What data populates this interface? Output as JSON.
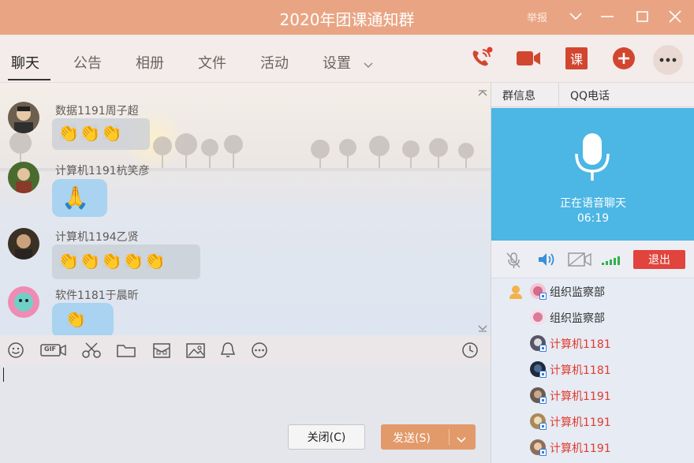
{
  "window": {
    "title": "2020年团课通知群",
    "report_label": "举报",
    "controls": [
      "chevron-down-icon",
      "minimize-icon",
      "maximize-icon",
      "close-icon"
    ]
  },
  "tabs": [
    {
      "label": "聊天",
      "active": true
    },
    {
      "label": "公告",
      "active": false
    },
    {
      "label": "相册",
      "active": false
    },
    {
      "label": "文件",
      "active": false
    },
    {
      "label": "活动",
      "active": false
    },
    {
      "label": "设置",
      "active": false
    }
  ],
  "actions": {
    "call_icon": "phone-call-icon",
    "video_icon": "video-camera-icon",
    "course_label": "课",
    "add_icon": "plus-circle-icon",
    "more_icon": "more-dots-icon"
  },
  "messages": [
    {
      "sender": "数据1191周子超",
      "content": "👏👏👏"
    },
    {
      "sender": "计算机1191杭笑彦",
      "content": "🙏"
    },
    {
      "sender": "计算机1194乙贤",
      "content": "👏👏👏👏👏"
    },
    {
      "sender": "软件1181于晨昕",
      "content": "👏"
    }
  ],
  "toolbar": {
    "icons": [
      "emoji-icon",
      "gif-icon",
      "scissors-icon",
      "folder-icon",
      "red-packet-icon",
      "image-icon",
      "bell-icon",
      "more-circle-icon",
      "history-clock-icon"
    ],
    "gif_label": "GIF"
  },
  "input": {
    "close_label": "关闭(C)",
    "send_label": "发送(S)"
  },
  "right_panel": {
    "tabs": [
      "群信息",
      "QQ电话"
    ],
    "voice": {
      "status": "正在语音聊天",
      "elapsed": "06:19"
    },
    "controls": {
      "exit_label": "退出"
    },
    "members": [
      {
        "name": "组织监察部",
        "color": "dark",
        "host": true
      },
      {
        "name": "组织监察部",
        "color": "dark",
        "host": false
      },
      {
        "name": "计算机1181",
        "color": "red",
        "host": false
      },
      {
        "name": "计算机1181",
        "color": "red",
        "host": false
      },
      {
        "name": "计算机1191",
        "color": "red",
        "host": false
      },
      {
        "name": "计算机1191",
        "color": "red",
        "host": false
      },
      {
        "name": "计算机1191",
        "color": "red",
        "host": false
      }
    ]
  }
}
